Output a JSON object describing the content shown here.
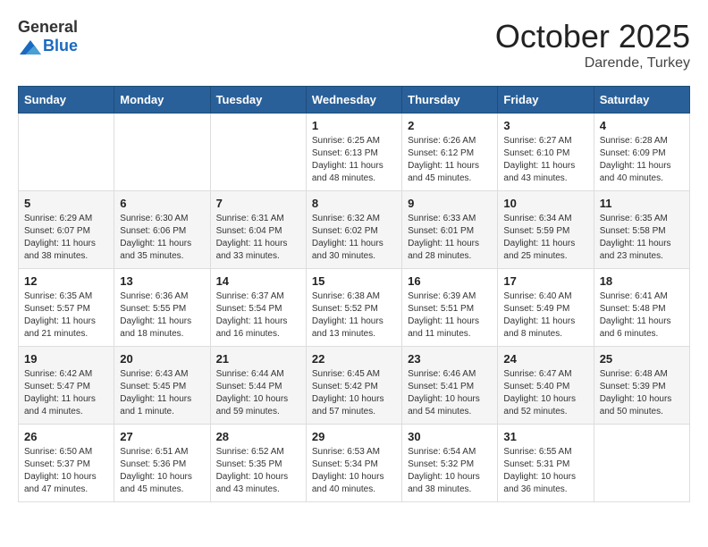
{
  "header": {
    "logo_general": "General",
    "logo_blue": "Blue",
    "month": "October 2025",
    "location": "Darende, Turkey"
  },
  "weekdays": [
    "Sunday",
    "Monday",
    "Tuesday",
    "Wednesday",
    "Thursday",
    "Friday",
    "Saturday"
  ],
  "weeks": [
    [
      {
        "day": "",
        "lines": []
      },
      {
        "day": "",
        "lines": []
      },
      {
        "day": "",
        "lines": []
      },
      {
        "day": "1",
        "lines": [
          "Sunrise: 6:25 AM",
          "Sunset: 6:13 PM",
          "Daylight: 11 hours",
          "and 48 minutes."
        ]
      },
      {
        "day": "2",
        "lines": [
          "Sunrise: 6:26 AM",
          "Sunset: 6:12 PM",
          "Daylight: 11 hours",
          "and 45 minutes."
        ]
      },
      {
        "day": "3",
        "lines": [
          "Sunrise: 6:27 AM",
          "Sunset: 6:10 PM",
          "Daylight: 11 hours",
          "and 43 minutes."
        ]
      },
      {
        "day": "4",
        "lines": [
          "Sunrise: 6:28 AM",
          "Sunset: 6:09 PM",
          "Daylight: 11 hours",
          "and 40 minutes."
        ]
      }
    ],
    [
      {
        "day": "5",
        "lines": [
          "Sunrise: 6:29 AM",
          "Sunset: 6:07 PM",
          "Daylight: 11 hours",
          "and 38 minutes."
        ]
      },
      {
        "day": "6",
        "lines": [
          "Sunrise: 6:30 AM",
          "Sunset: 6:06 PM",
          "Daylight: 11 hours",
          "and 35 minutes."
        ]
      },
      {
        "day": "7",
        "lines": [
          "Sunrise: 6:31 AM",
          "Sunset: 6:04 PM",
          "Daylight: 11 hours",
          "and 33 minutes."
        ]
      },
      {
        "day": "8",
        "lines": [
          "Sunrise: 6:32 AM",
          "Sunset: 6:02 PM",
          "Daylight: 11 hours",
          "and 30 minutes."
        ]
      },
      {
        "day": "9",
        "lines": [
          "Sunrise: 6:33 AM",
          "Sunset: 6:01 PM",
          "Daylight: 11 hours",
          "and 28 minutes."
        ]
      },
      {
        "day": "10",
        "lines": [
          "Sunrise: 6:34 AM",
          "Sunset: 5:59 PM",
          "Daylight: 11 hours",
          "and 25 minutes."
        ]
      },
      {
        "day": "11",
        "lines": [
          "Sunrise: 6:35 AM",
          "Sunset: 5:58 PM",
          "Daylight: 11 hours",
          "and 23 minutes."
        ]
      }
    ],
    [
      {
        "day": "12",
        "lines": [
          "Sunrise: 6:35 AM",
          "Sunset: 5:57 PM",
          "Daylight: 11 hours",
          "and 21 minutes."
        ]
      },
      {
        "day": "13",
        "lines": [
          "Sunrise: 6:36 AM",
          "Sunset: 5:55 PM",
          "Daylight: 11 hours",
          "and 18 minutes."
        ]
      },
      {
        "day": "14",
        "lines": [
          "Sunrise: 6:37 AM",
          "Sunset: 5:54 PM",
          "Daylight: 11 hours",
          "and 16 minutes."
        ]
      },
      {
        "day": "15",
        "lines": [
          "Sunrise: 6:38 AM",
          "Sunset: 5:52 PM",
          "Daylight: 11 hours",
          "and 13 minutes."
        ]
      },
      {
        "day": "16",
        "lines": [
          "Sunrise: 6:39 AM",
          "Sunset: 5:51 PM",
          "Daylight: 11 hours",
          "and 11 minutes."
        ]
      },
      {
        "day": "17",
        "lines": [
          "Sunrise: 6:40 AM",
          "Sunset: 5:49 PM",
          "Daylight: 11 hours",
          "and 8 minutes."
        ]
      },
      {
        "day": "18",
        "lines": [
          "Sunrise: 6:41 AM",
          "Sunset: 5:48 PM",
          "Daylight: 11 hours",
          "and 6 minutes."
        ]
      }
    ],
    [
      {
        "day": "19",
        "lines": [
          "Sunrise: 6:42 AM",
          "Sunset: 5:47 PM",
          "Daylight: 11 hours",
          "and 4 minutes."
        ]
      },
      {
        "day": "20",
        "lines": [
          "Sunrise: 6:43 AM",
          "Sunset: 5:45 PM",
          "Daylight: 11 hours",
          "and 1 minute."
        ]
      },
      {
        "day": "21",
        "lines": [
          "Sunrise: 6:44 AM",
          "Sunset: 5:44 PM",
          "Daylight: 10 hours",
          "and 59 minutes."
        ]
      },
      {
        "day": "22",
        "lines": [
          "Sunrise: 6:45 AM",
          "Sunset: 5:42 PM",
          "Daylight: 10 hours",
          "and 57 minutes."
        ]
      },
      {
        "day": "23",
        "lines": [
          "Sunrise: 6:46 AM",
          "Sunset: 5:41 PM",
          "Daylight: 10 hours",
          "and 54 minutes."
        ]
      },
      {
        "day": "24",
        "lines": [
          "Sunrise: 6:47 AM",
          "Sunset: 5:40 PM",
          "Daylight: 10 hours",
          "and 52 minutes."
        ]
      },
      {
        "day": "25",
        "lines": [
          "Sunrise: 6:48 AM",
          "Sunset: 5:39 PM",
          "Daylight: 10 hours",
          "and 50 minutes."
        ]
      }
    ],
    [
      {
        "day": "26",
        "lines": [
          "Sunrise: 6:50 AM",
          "Sunset: 5:37 PM",
          "Daylight: 10 hours",
          "and 47 minutes."
        ]
      },
      {
        "day": "27",
        "lines": [
          "Sunrise: 6:51 AM",
          "Sunset: 5:36 PM",
          "Daylight: 10 hours",
          "and 45 minutes."
        ]
      },
      {
        "day": "28",
        "lines": [
          "Sunrise: 6:52 AM",
          "Sunset: 5:35 PM",
          "Daylight: 10 hours",
          "and 43 minutes."
        ]
      },
      {
        "day": "29",
        "lines": [
          "Sunrise: 6:53 AM",
          "Sunset: 5:34 PM",
          "Daylight: 10 hours",
          "and 40 minutes."
        ]
      },
      {
        "day": "30",
        "lines": [
          "Sunrise: 6:54 AM",
          "Sunset: 5:32 PM",
          "Daylight: 10 hours",
          "and 38 minutes."
        ]
      },
      {
        "day": "31",
        "lines": [
          "Sunrise: 6:55 AM",
          "Sunset: 5:31 PM",
          "Daylight: 10 hours",
          "and 36 minutes."
        ]
      },
      {
        "day": "",
        "lines": []
      }
    ]
  ]
}
